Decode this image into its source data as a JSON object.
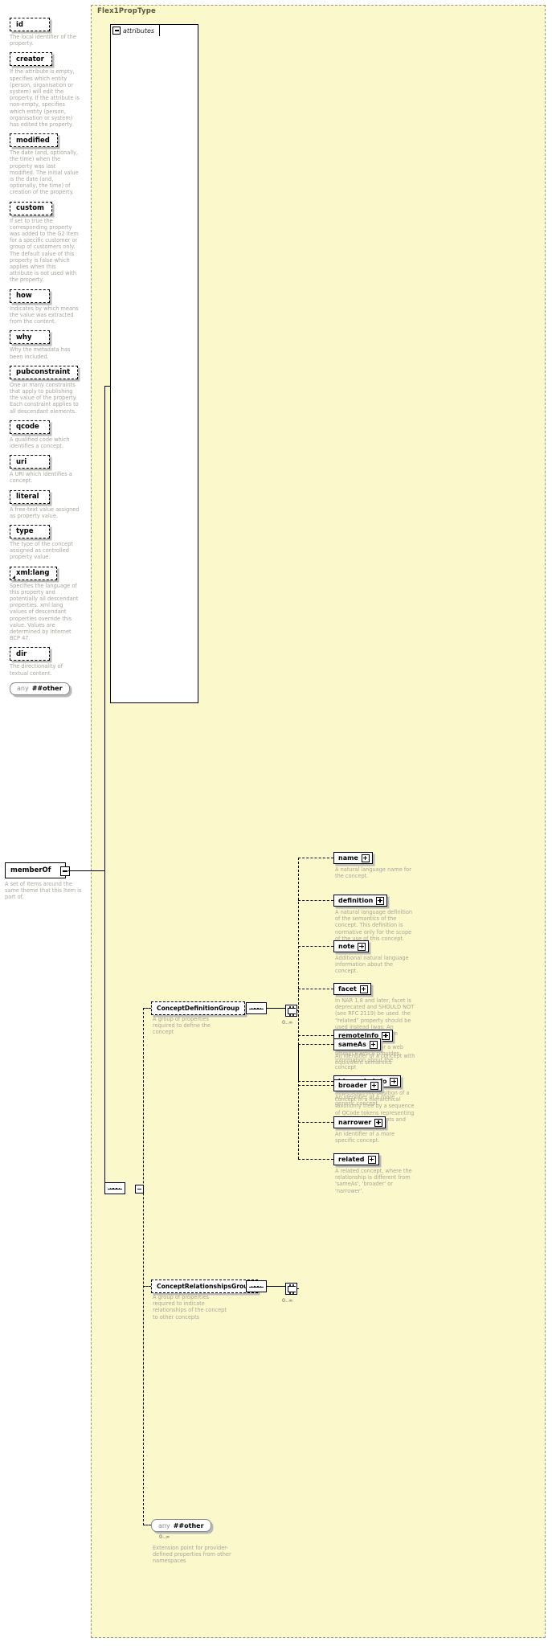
{
  "type_name": "Flex1PropType",
  "attributes_section": {
    "tab_label": "attributes",
    "toggle_icon": "minus-box-icon",
    "items": [
      {
        "name": "id",
        "desc": "The local identifier of the property."
      },
      {
        "name": "creator",
        "desc": "If the attribute is empty, specifies which entity (person, organisation or system) will edit the property. If the attribute is non-empty, specifies which entity (person, organisation or system) has edited the property."
      },
      {
        "name": "modified",
        "desc": "The date (and, optionally, the time) when the property was last modified. The initial value is the date (and, optionally, the time) of creation of the property."
      },
      {
        "name": "custom",
        "desc": "If set to true the corresponding property was added to the G2 Item for a specific customer or group of customers only. The default value of this property is false which applies when this attribute is not used with the property."
      },
      {
        "name": "how",
        "desc": "Indicates by which means the value was extracted from the content."
      },
      {
        "name": "why",
        "desc": "Why the metadata has been included."
      },
      {
        "name": "pubconstraint",
        "desc": "One or many constraints that apply to publishing the value of the property. Each constraint applies to all descendant elements."
      },
      {
        "name": "qcode",
        "desc": "A qualified code which identifies a concept."
      },
      {
        "name": "uri",
        "desc": "A URI which identifies a concept."
      },
      {
        "name": "literal",
        "desc": "A free-text value assigned as property value."
      },
      {
        "name": "type",
        "desc": "The type of the concept assigned as controlled property value."
      },
      {
        "name": "xml:lang",
        "desc": "Specifies the language of this property and potentially all descendant properties. xml:lang values of descendant properties override this value. Values are determined by Internet BCP 47.",
        "is_ref": true
      },
      {
        "name": "dir",
        "desc": "The directionality of textual content."
      }
    ],
    "any_other": {
      "prefix": "any",
      "label": "##other"
    }
  },
  "member_of": {
    "label": "memberOf",
    "desc": "A set of Items around the same theme that this Item is part of.",
    "toggle_icon": "minus-box-icon"
  },
  "groups": [
    {
      "id": "concept-definition-group",
      "label": "ConceptDefinitionGroup",
      "desc": "A group of properties required to define the concept",
      "occurs": "0..∞",
      "children": [
        {
          "name": "name",
          "desc": "A natural language name for the concept."
        },
        {
          "name": "definition",
          "desc": "A natural language definition of the semantics of the concept. This definition is normative only for the scope of the use of this concept."
        },
        {
          "name": "note",
          "desc": "Additional natural language information about the concept."
        },
        {
          "name": "facet",
          "desc": "In NAR 1.8 and later, facet is deprecated and SHOULD NOT (see RFC 2119) be used. the “related” property should be used instead (was: An intrinsic property of the concept.)"
        },
        {
          "name": "remoteInfo",
          "desc": "A link to an item or a web resource which provides information about the concept"
        },
        {
          "name": "hierarchyInfo",
          "desc": "Represents the position of a concept in a hierarchical taxonomy tree by a sequence of QCode tokens representing the ancestor concepts and this concept"
        }
      ]
    },
    {
      "id": "concept-relationships-group",
      "label": "ConceptRelationshipsGroup",
      "desc": "A group of properties required to indicate relationships of the concept to other concepts",
      "occurs": "0..∞",
      "children": [
        {
          "name": "sameAs",
          "desc": "An identifier of a concept with equivalent semantics"
        },
        {
          "name": "broader",
          "desc": "An identifier of a more generic concept."
        },
        {
          "name": "narrower",
          "desc": "An identifier of a more specific concept."
        },
        {
          "name": "related",
          "desc": "A related concept, where the relationship is different from 'sameAs', 'broader' or 'narrower'."
        }
      ]
    }
  ],
  "any_other_bottom": {
    "prefix": "any",
    "label": "##other",
    "occurs": "0..∞",
    "desc": "Extension point for provider-defined properties from other namespaces"
  },
  "colors": {
    "type_background": "#FBF8CC",
    "description_text": "#a9a59b",
    "shadow": "#b9b9b9",
    "border": "#000000"
  }
}
